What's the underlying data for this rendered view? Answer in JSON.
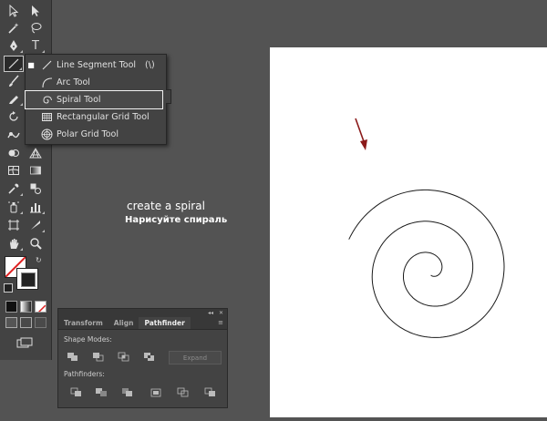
{
  "toolbar": {
    "tools": [
      {
        "name": "selection-tool",
        "icon": "selection-arrow-icon"
      },
      {
        "name": "direct-selection-tool",
        "icon": "direct-selection-icon"
      },
      {
        "name": "magic-wand-tool",
        "icon": "magic-wand-icon"
      },
      {
        "name": "lasso-tool",
        "icon": "lasso-icon"
      },
      {
        "name": "pen-tool",
        "icon": "pen-icon"
      },
      {
        "name": "type-tool",
        "icon": "type-icon",
        "glyph": "T"
      },
      {
        "name": "line-segment-tool",
        "icon": "line-segment-icon",
        "active": true
      },
      {
        "name": "paintbrush-tool",
        "icon": "paintbrush-icon"
      },
      {
        "name": "pencil-tool",
        "icon": "pencil-icon"
      },
      {
        "name": "rotate-tool",
        "icon": "rotate-icon"
      },
      {
        "name": "warp-tool",
        "icon": "warp-icon"
      },
      {
        "name": "shape-builder-tool",
        "icon": "shape-builder-icon"
      },
      {
        "name": "perspective-grid-tool",
        "icon": "perspective-grid-icon"
      },
      {
        "name": "mesh-tool",
        "icon": "mesh-icon"
      },
      {
        "name": "gradient-tool",
        "icon": "gradient-icon"
      },
      {
        "name": "eyedropper-tool",
        "icon": "eyedropper-icon"
      },
      {
        "name": "blend-tool",
        "icon": "blend-icon"
      },
      {
        "name": "symbol-sprayer-tool",
        "icon": "symbol-sprayer-icon"
      },
      {
        "name": "column-graph-tool",
        "icon": "column-graph-icon"
      },
      {
        "name": "artboard-tool",
        "icon": "artboard-icon"
      },
      {
        "name": "slice-tool",
        "icon": "slice-icon"
      },
      {
        "name": "hand-tool",
        "icon": "hand-icon"
      },
      {
        "name": "zoom-tool",
        "icon": "zoom-icon"
      }
    ]
  },
  "flyout": {
    "items": [
      {
        "label": "Line Segment Tool",
        "shortcut": "(\\)",
        "icon": "line-segment-icon",
        "selected": true
      },
      {
        "label": "Arc Tool",
        "icon": "arc-icon"
      },
      {
        "label": "Spiral Tool",
        "icon": "spiral-icon",
        "highlighted": true
      },
      {
        "label": "Rectangular Grid Tool",
        "icon": "rectangular-grid-icon"
      },
      {
        "label": "Polar Grid Tool",
        "icon": "polar-grid-icon"
      }
    ]
  },
  "annotation": {
    "english": "create a spiral",
    "russian": "Нарисуйте спираль"
  },
  "panel": {
    "tabs": [
      "Transform",
      "Align",
      "Pathfinder"
    ],
    "active_tab": "Pathfinder",
    "collapse_glyph": "◂◂",
    "close_glyph": "✕",
    "menu_glyph": "≡",
    "shape_modes_label": "Shape Modes:",
    "expand_label": "Expand",
    "pathfinders_label": "Pathfinders:"
  },
  "colors": {
    "workspace": "#535353",
    "panel": "#434343",
    "canvas": "#ffffff",
    "arrow": "#8b1a1a",
    "spiral_stroke": "#1a1a1a"
  }
}
